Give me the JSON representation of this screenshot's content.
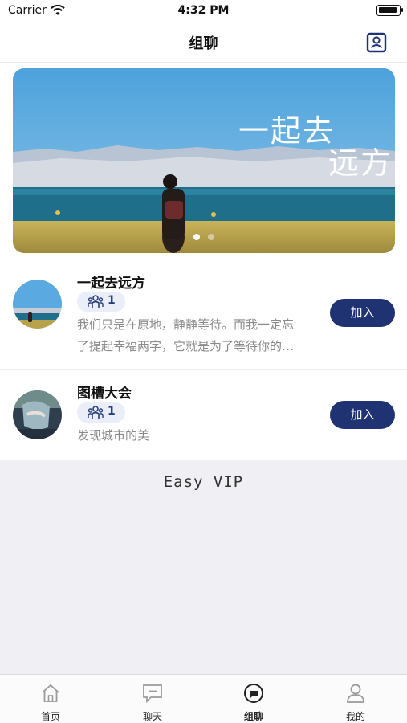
{
  "status_bar": {
    "carrier": "Carrier",
    "time": "4:32 PM"
  },
  "navbar": {
    "title": "组聊",
    "contacts_icon": "contacts-icon"
  },
  "banner": {
    "line1": "一起去",
    "line2": "远方",
    "pages": 2,
    "active_page": 1
  },
  "groups": [
    {
      "name": "一起去远方",
      "members": "1",
      "description": "我们只是在原地，静静等待。而我一定忘了提起幸福两字，它就是为了等待你的到来。",
      "join_label": "加入"
    },
    {
      "name": "图槽大会",
      "members": "1",
      "description": "发现城市的美",
      "join_label": "加入"
    }
  ],
  "footer": {
    "brand": "Easy VIP"
  },
  "tabs": [
    {
      "label": "首页",
      "icon": "home-icon"
    },
    {
      "label": "聊天",
      "icon": "chat-icon"
    },
    {
      "label": "组聊",
      "icon": "group-chat-icon",
      "active": true
    },
    {
      "label": "我的",
      "icon": "profile-icon"
    }
  ],
  "colors": {
    "accent": "#1f3372",
    "badge_bg": "#e9eef8",
    "background": "#efeff4"
  }
}
